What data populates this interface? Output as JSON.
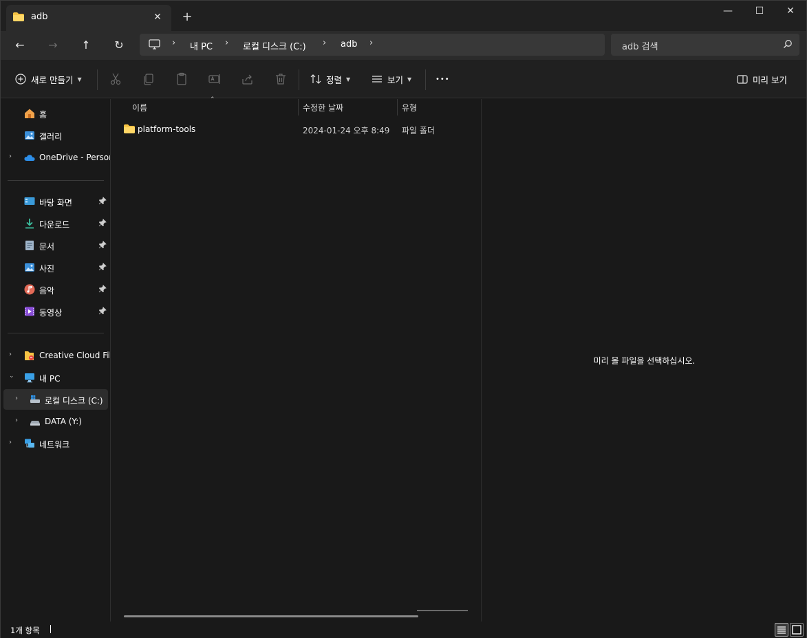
{
  "tab": {
    "title": "adb",
    "close": "✕",
    "new_tab": "+"
  },
  "window_controls": {
    "minimize": "—",
    "maximize": "☐",
    "close": "✕"
  },
  "nav": {
    "back": "←",
    "forward": "→",
    "up": "↑",
    "refresh": "↻"
  },
  "breadcrumb": [
    "내 PC",
    "로컬 디스크 (C:)",
    "adb"
  ],
  "breadcrumb_sep": "›",
  "search": {
    "placeholder": "adb 검색"
  },
  "toolbar": {
    "new_label": "새로 만들기",
    "sort_label": "정렬",
    "view_label": "보기",
    "more_label": "•••",
    "preview_label": "미리 보기"
  },
  "sidebar": {
    "home": "홈",
    "gallery": "갤러리",
    "onedrive": "OneDrive - Personal",
    "quick": [
      {
        "label": "바탕 화면",
        "icon": "desktop-icon"
      },
      {
        "label": "다운로드",
        "icon": "download-icon"
      },
      {
        "label": "문서",
        "icon": "documents-icon"
      },
      {
        "label": "사진",
        "icon": "pictures-icon"
      },
      {
        "label": "음악",
        "icon": "music-icon"
      },
      {
        "label": "동영상",
        "icon": "videos-icon"
      }
    ],
    "creative_cloud": "Creative Cloud Files",
    "this_pc": "내 PC",
    "local_disk": "로컬 디스크 (C:)",
    "data_drive": "DATA (Y:)",
    "network": "네트워크"
  },
  "columns": {
    "name": "이름",
    "modified": "수정한 날짜",
    "type": "유형"
  },
  "files": [
    {
      "name": "platform-tools",
      "modified": "2024-01-24 오후 8:49",
      "type": "파일 폴더"
    }
  ],
  "preview": {
    "message": "미리 볼 파일을 선택하십시오."
  },
  "status": {
    "count": "1개 항목"
  },
  "colors": {
    "accent": "#4cc2ff",
    "folder": "#f6c344",
    "background": "#191919"
  }
}
